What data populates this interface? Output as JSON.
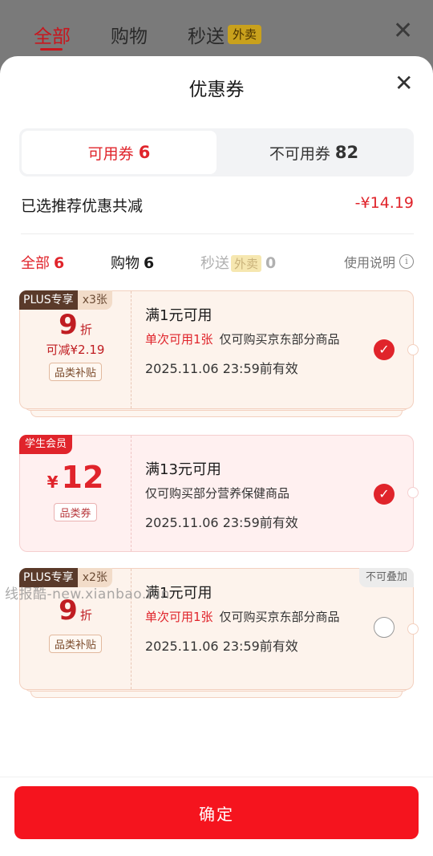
{
  "backdrop": {
    "tabs": [
      {
        "label": "全部",
        "active": true
      },
      {
        "label": "购物",
        "active": false
      },
      {
        "label": "秒送",
        "active": false
      }
    ],
    "badge": "外卖",
    "close_icon": "close-icon"
  },
  "sheet": {
    "title": "优惠券",
    "segments": {
      "available": {
        "label": "可用券",
        "count": "6"
      },
      "unavailable": {
        "label": "不可用券",
        "count": "82"
      }
    },
    "summary": {
      "label": "已选推荐优惠共减",
      "value": "-¥14.19"
    },
    "filters": [
      {
        "label": "全部",
        "count": "6"
      },
      {
        "label": "购物",
        "count": "6"
      },
      {
        "label": "秒送",
        "badge": "外卖",
        "count": "0"
      }
    ],
    "usage_label": "使用说明",
    "coupons": [
      {
        "tag_plus": "PLUS专享",
        "tag_count": "x3张",
        "discount": "9",
        "discount_unit": "折",
        "saving": "可减¥2.19",
        "pill": "品类补贴",
        "condition": "满1元可用",
        "desc_red": "单次可用1张",
        "desc": "仅可购买京东部分商品",
        "valid": "2025.11.06 23:59前有效",
        "checked": true
      },
      {
        "tag_student": "学生会员",
        "currency": "¥",
        "amount": "12",
        "pill": "品类券",
        "condition": "满13元可用",
        "desc": "仅可购买部分营养保健商品",
        "valid": "2025.11.06 23:59前有效",
        "checked": true
      },
      {
        "tag_plus": "PLUS专享",
        "tag_count": "x2张",
        "no_stack": "不可叠加",
        "discount": "9",
        "discount_unit": "折",
        "pill": "品类补贴",
        "condition": "满1元可用",
        "desc_red": "单次可用1张",
        "desc": "仅可购买京东部分商品",
        "valid": "2025.11.06 23:59前有效",
        "checked": false
      }
    ],
    "confirm_label": "确定"
  },
  "watermark": "线报酷-new.xianbao.fun",
  "colors": {
    "accent": "#e0242b",
    "button": "#f5141e"
  }
}
